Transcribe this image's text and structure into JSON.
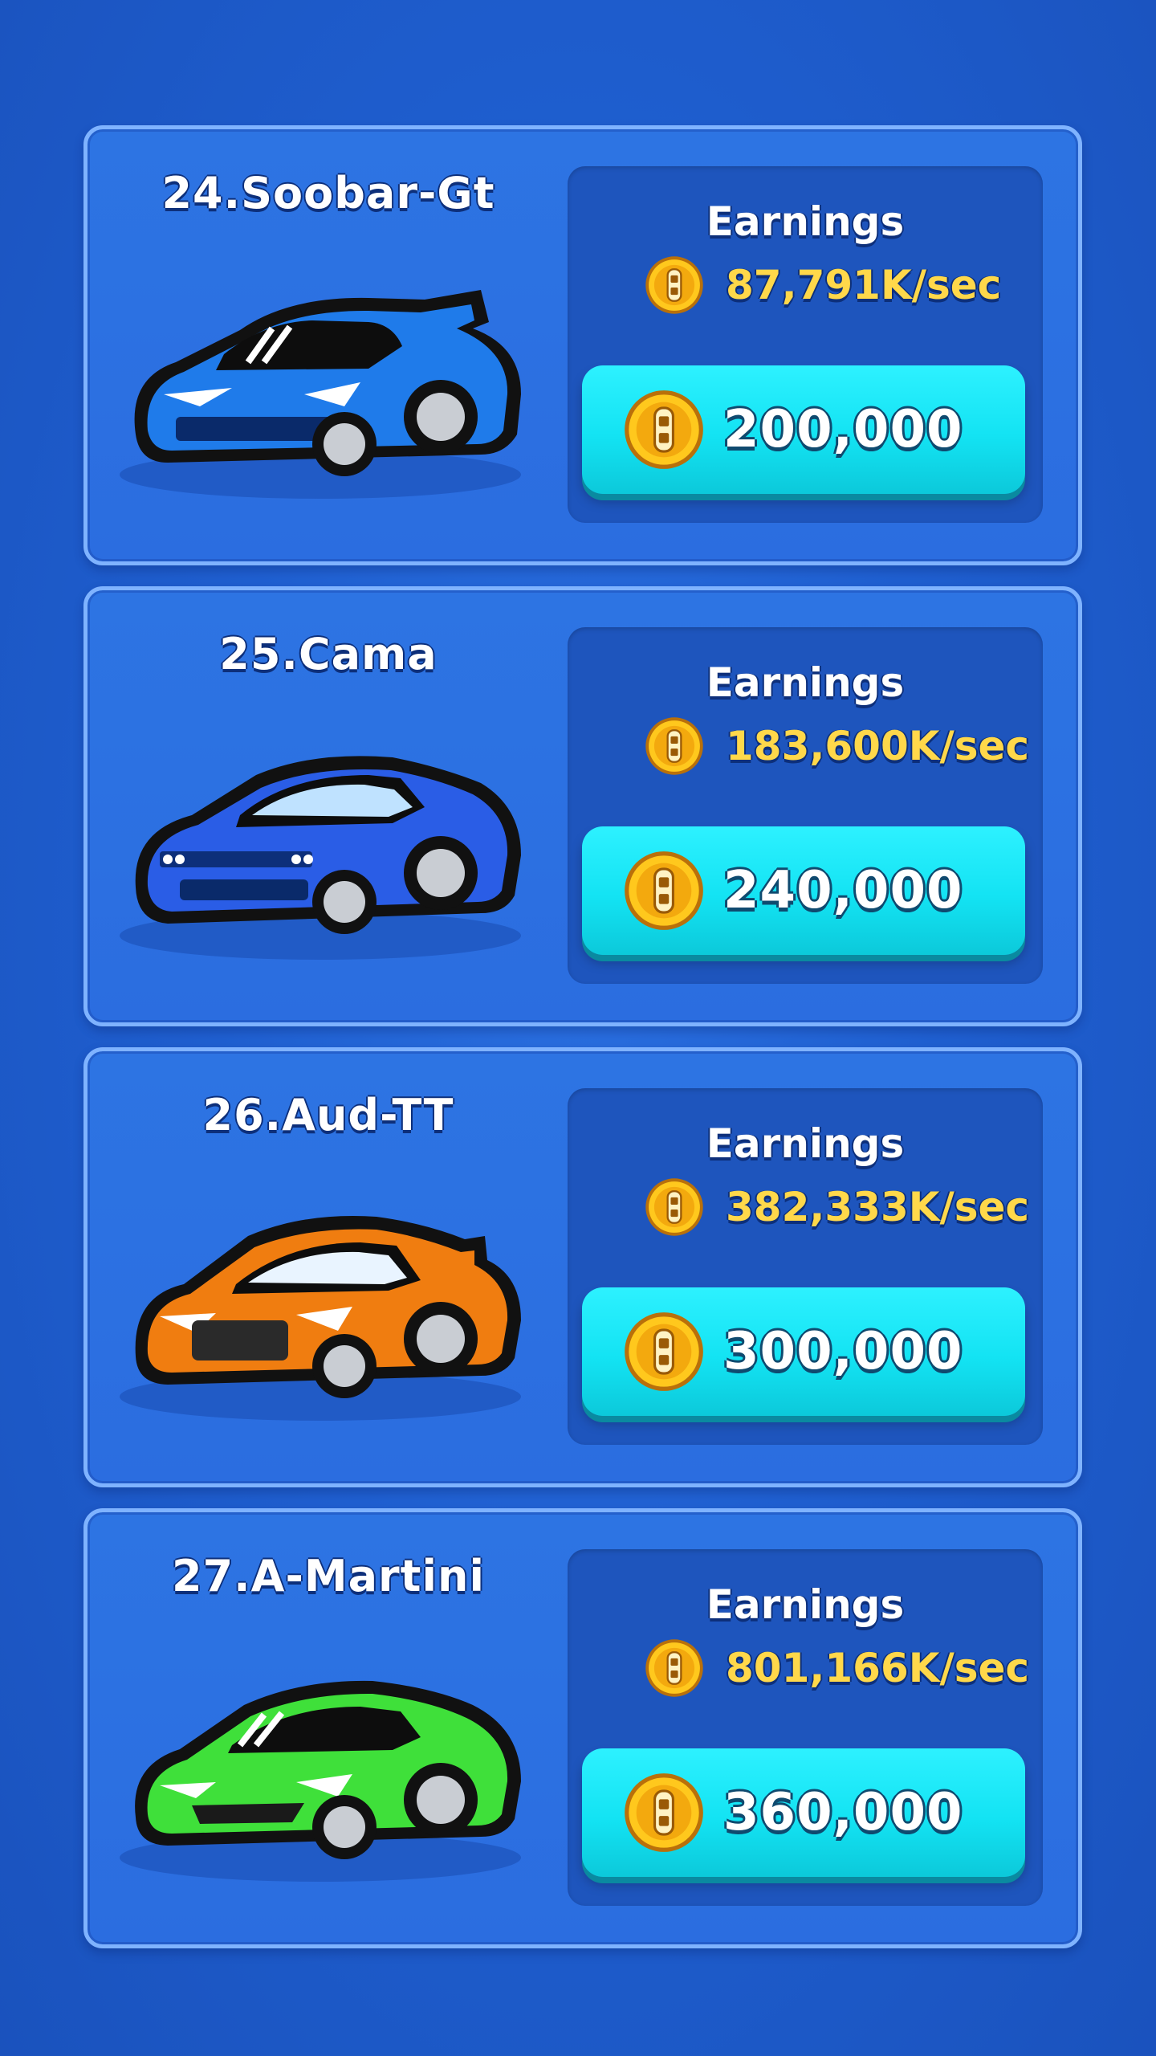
{
  "cars": [
    {
      "title": "24.Soobar-Gt",
      "earnings_label": "Earnings",
      "earnings_value": "87,791K/sec",
      "price": "200,000",
      "color": "#1f7bea",
      "icon": "blue-sports-car-icon"
    },
    {
      "title": "25.Cama",
      "earnings_label": "Earnings",
      "earnings_value": "183,600K/sec",
      "price": "240,000",
      "color": "#2a5de6",
      "icon": "blue-muscle-car-icon"
    },
    {
      "title": "26.Aud-TT",
      "earnings_label": "Earnings",
      "earnings_value": "382,333K/sec",
      "price": "300,000",
      "color": "#f07d10",
      "icon": "orange-coupe-icon"
    },
    {
      "title": "27.A-Martini",
      "earnings_label": "Earnings",
      "earnings_value": "801,166K/sec",
      "price": "360,000",
      "color": "#3fe03a",
      "icon": "green-sports-car-icon"
    }
  ],
  "coin_icon": "gold-coin-icon",
  "colors": {
    "background": "#1f5fd0",
    "card": "#2d74e3",
    "panel": "#1e55bd",
    "button": "#13e3f3",
    "earnings_text": "#ffd84a"
  }
}
